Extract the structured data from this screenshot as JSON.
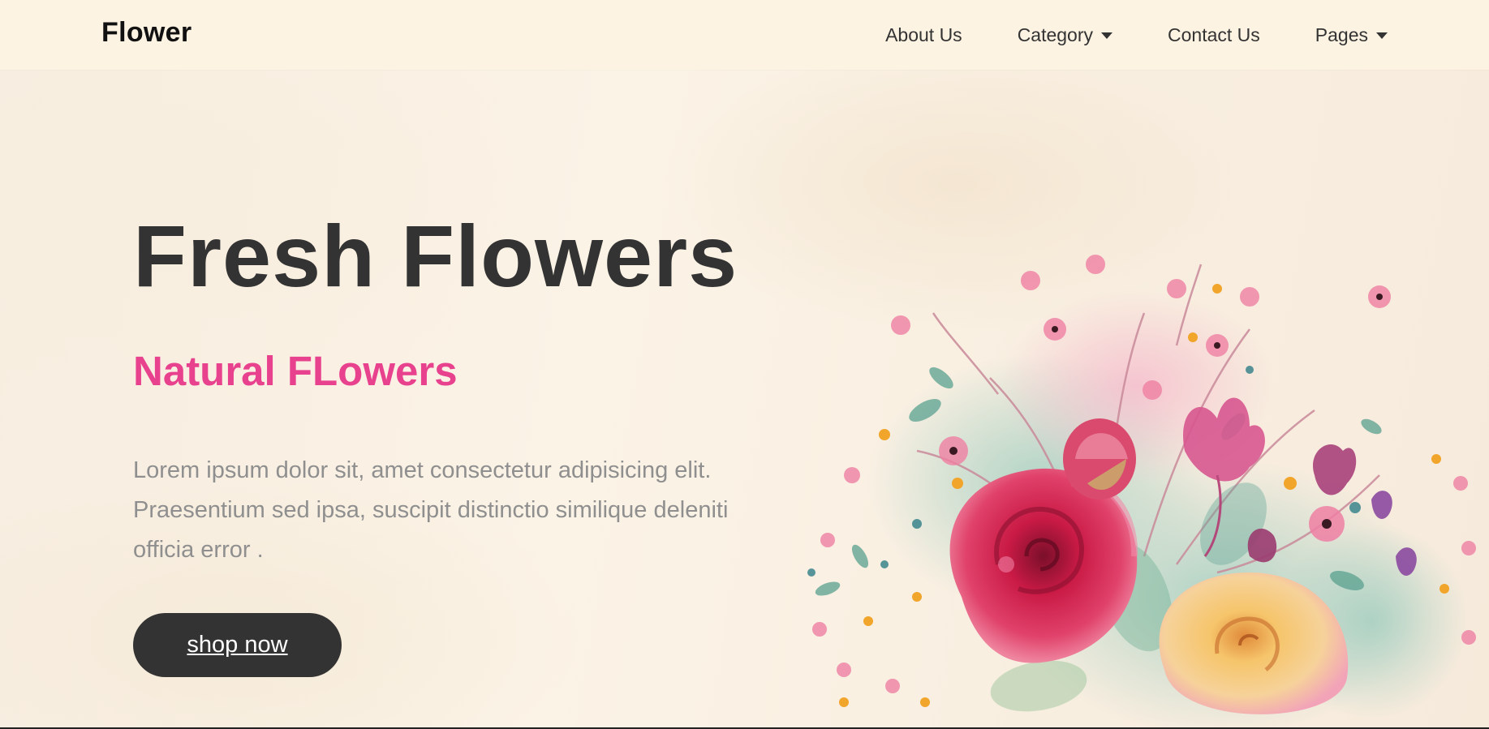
{
  "brand": {
    "logo_text": "Flower"
  },
  "nav": {
    "items": [
      {
        "label": "About Us",
        "has_dropdown": false
      },
      {
        "label": "Category",
        "has_dropdown": true
      },
      {
        "label": "Contact Us",
        "has_dropdown": false
      },
      {
        "label": "Pages",
        "has_dropdown": true
      }
    ]
  },
  "hero": {
    "title": "Fresh Flowers",
    "subtitle": "Natural FLowers",
    "description_lines": [
      "Lorem ipsum dolor sit, amet consectetur adipisicing elit.",
      "Praesentium sed ipsa, suscipit distinctio similique deleniti",
      "officia error ."
    ],
    "cta_label": "shop now"
  },
  "colors": {
    "nav_background": "#fdf3e3",
    "hero_background": "#f9efe1",
    "title": "#333333",
    "accent_pink": "#e8428e",
    "body_text": "#8f8f8f",
    "button_background": "#333333",
    "button_text": "#ffffff"
  },
  "images": {
    "bouquet": "watercolor-flower-bouquet-illustration"
  }
}
